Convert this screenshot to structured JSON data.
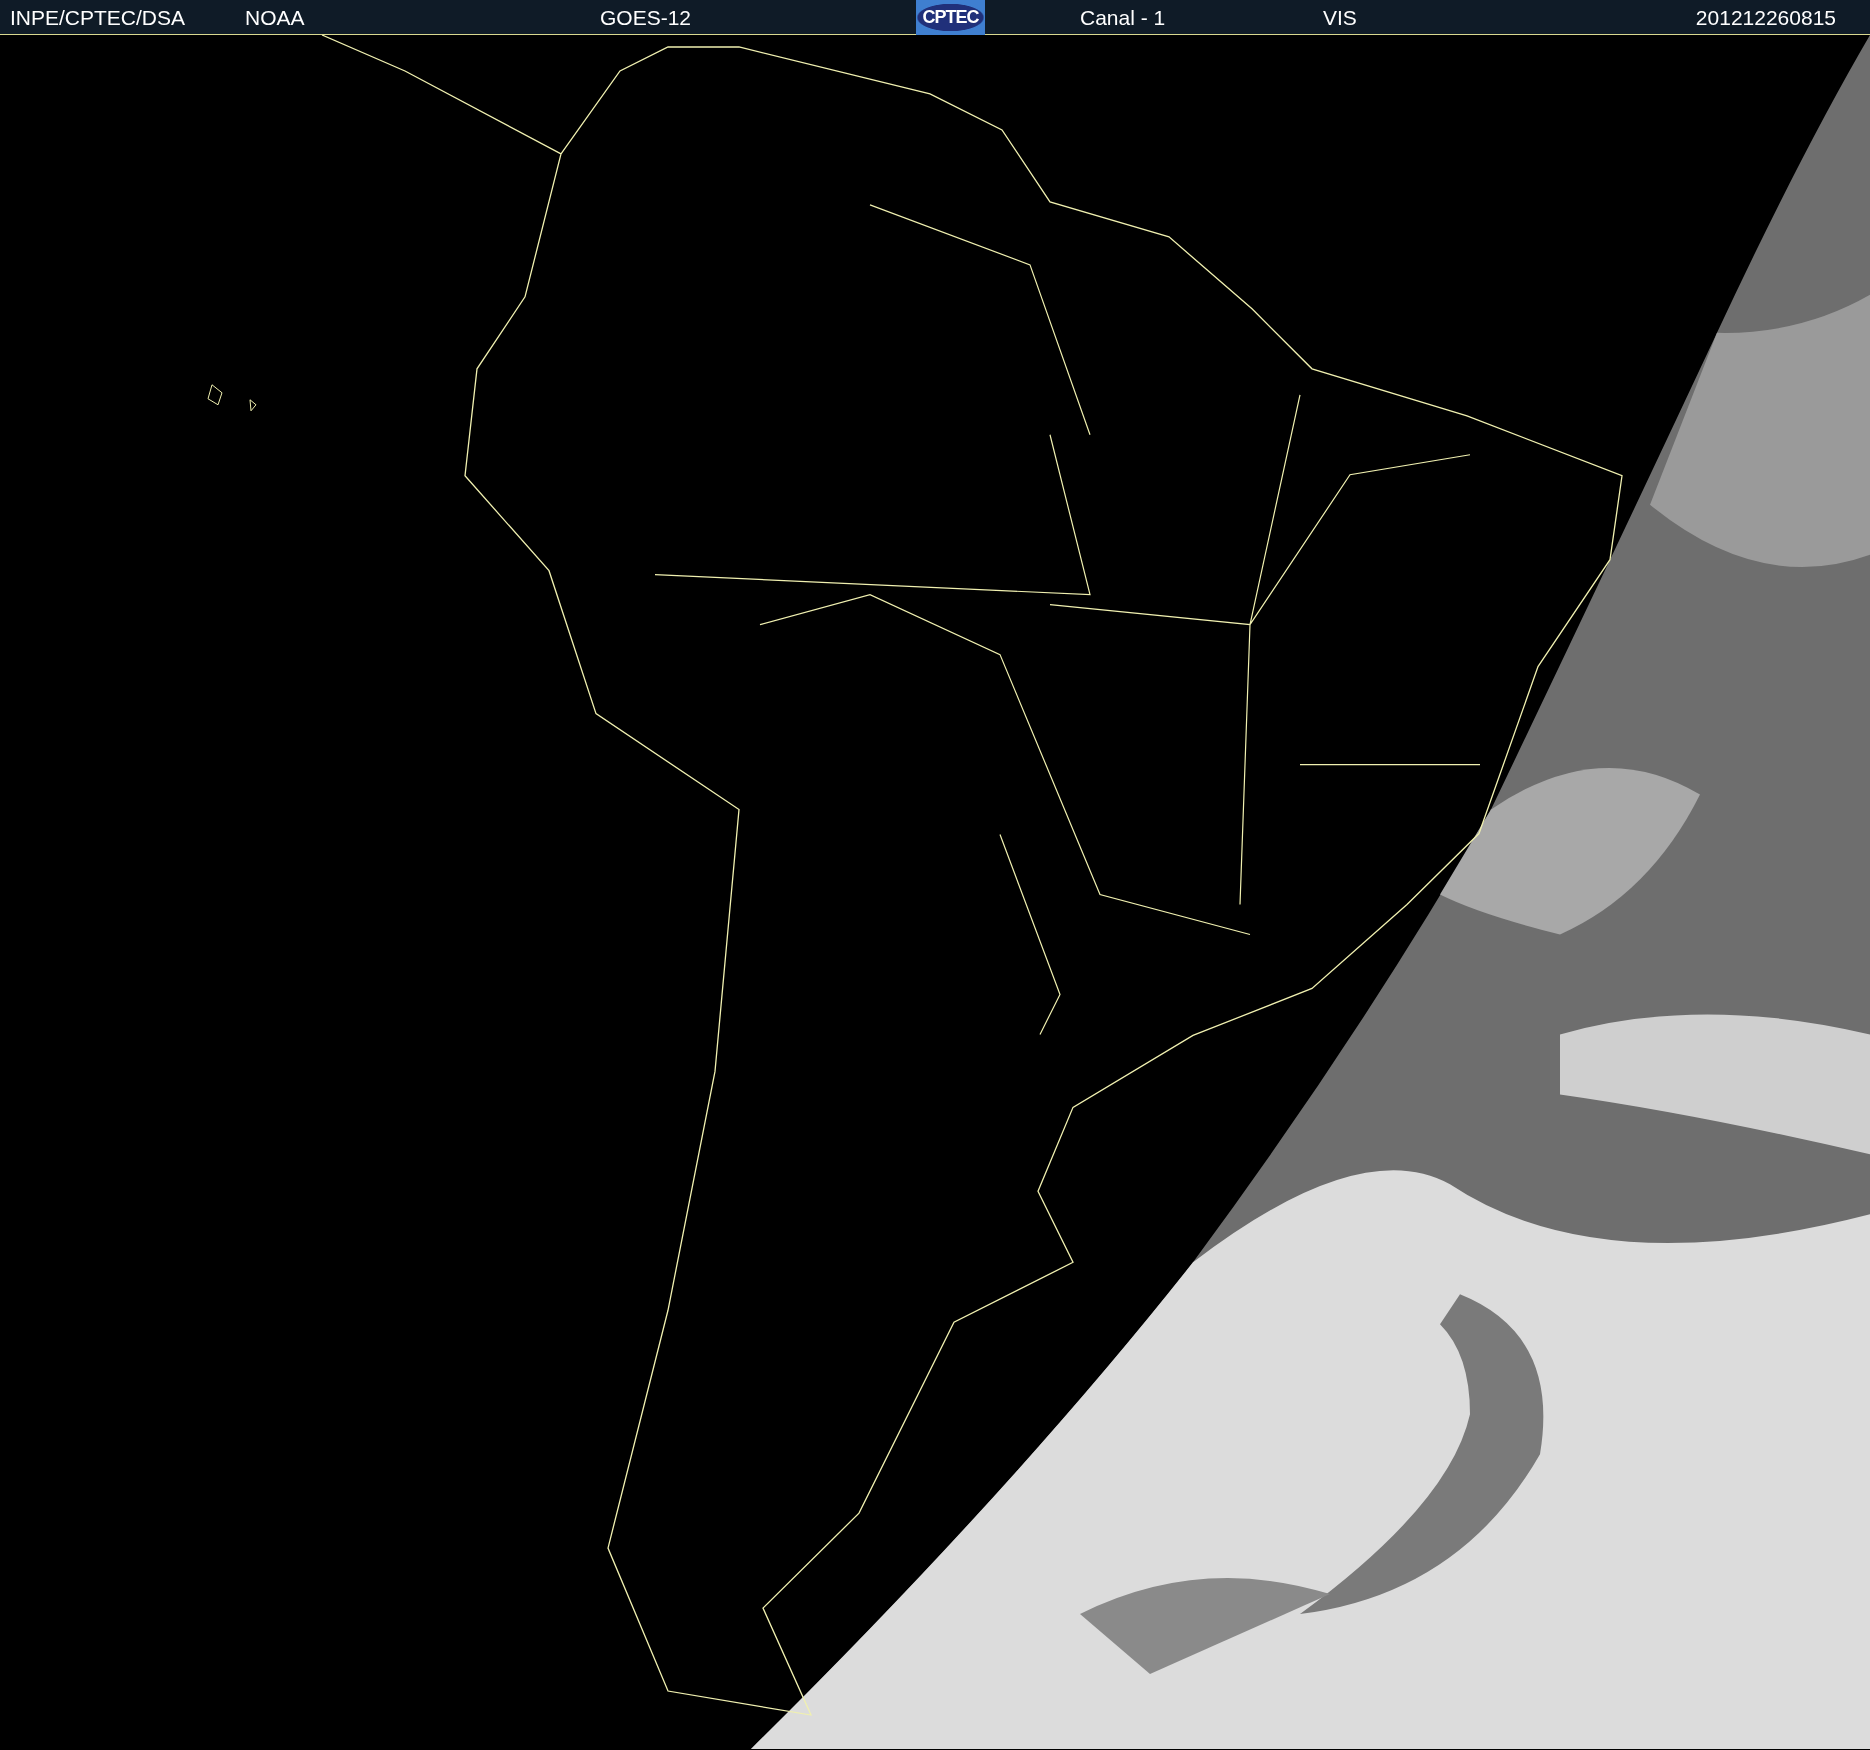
{
  "header": {
    "items": [
      {
        "kind": "text",
        "text": "INPE/CPTEC/DSA"
      },
      {
        "kind": "text",
        "text": "NOAA"
      },
      {
        "kind": "text",
        "text": "GOES-12"
      },
      {
        "kind": "logo",
        "text": "CPTEC"
      },
      {
        "kind": "text",
        "text": "Canal - 1"
      },
      {
        "kind": "text",
        "text": "VIS"
      },
      {
        "kind": "text",
        "text": "201212260815"
      }
    ]
  }
}
